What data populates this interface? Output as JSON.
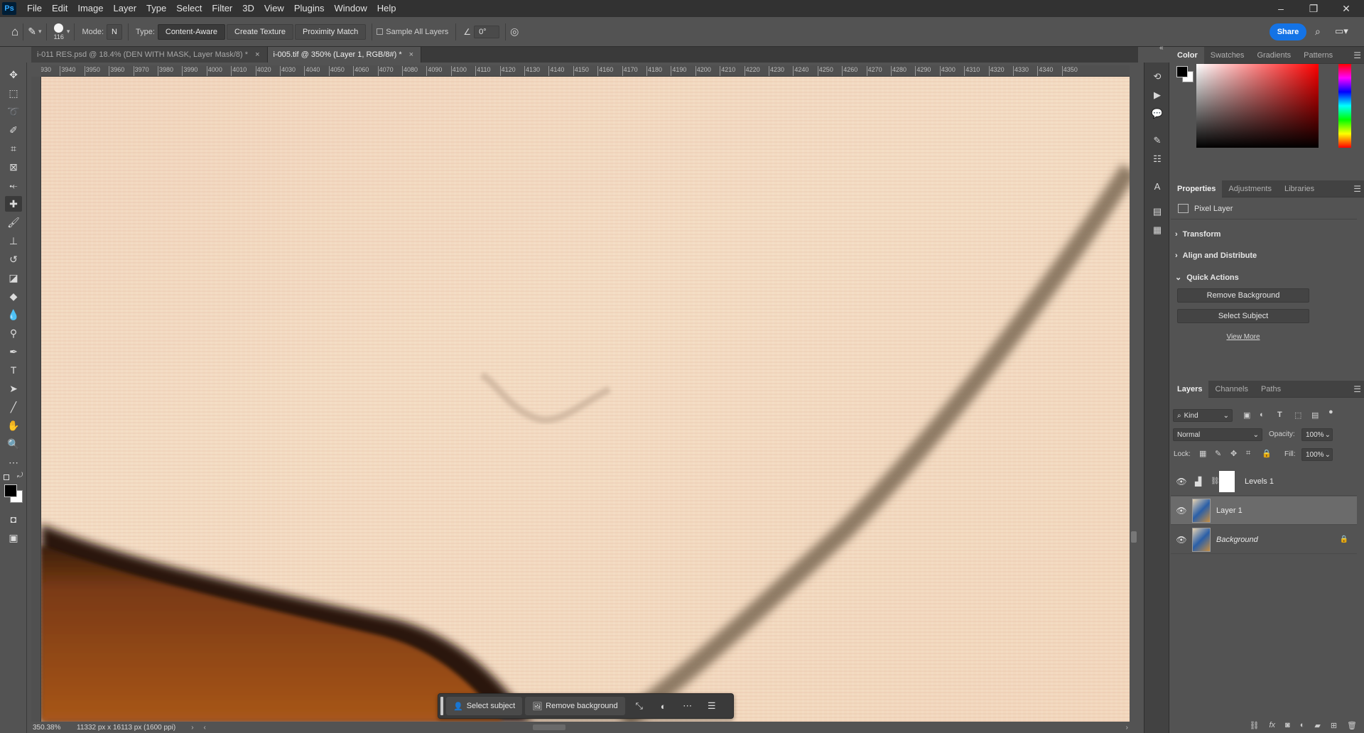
{
  "app": {
    "logo": "Ps"
  },
  "menu": [
    "File",
    "Edit",
    "Image",
    "Layer",
    "Type",
    "Select",
    "Filter",
    "3D",
    "View",
    "Plugins",
    "Window",
    "Help"
  ],
  "window_controls": {
    "minimize": "–",
    "restore": "❐",
    "close": "✕"
  },
  "options_bar": {
    "brush_size": "116",
    "mode_label": "Mode:",
    "mode_value": "N",
    "type_label": "Type:",
    "type_buttons": [
      "Content-Aware",
      "Create Texture",
      "Proximity Match"
    ],
    "sample_all_layers": "Sample All Layers",
    "angle": "0°",
    "share": "Share"
  },
  "tabs": [
    {
      "label": "i-011 RES.psd @ 18.4% (DEN WITH MASK, Layer Mask/8) *",
      "active": false
    },
    {
      "label": "i-005.tif @ 350% (Layer 1, RGB/8#) *",
      "active": true
    }
  ],
  "ruler_ticks": [
    "3930",
    "3940",
    "3950",
    "3960",
    "3970",
    "3980",
    "3990",
    "4000",
    "4010",
    "4020",
    "4030",
    "4040",
    "4050",
    "4060",
    "4070",
    "4080",
    "4090",
    "4100",
    "4110",
    "4120",
    "4130",
    "4140",
    "4150",
    "4160",
    "4170",
    "4180",
    "4190",
    "4200",
    "4210",
    "4220",
    "4230",
    "4240",
    "4250",
    "4260",
    "4270",
    "4280",
    "4290",
    "4300",
    "4310",
    "4320",
    "4330",
    "4340",
    "4350"
  ],
  "status": {
    "zoom": "350.38%",
    "doc_info": "11332 px x 16113 px (1600 ppi)"
  },
  "context_bar": {
    "select_subject": "Select subject",
    "remove_background": "Remove background"
  },
  "color_panel": {
    "tabs": [
      "Color",
      "Swatches",
      "Gradients",
      "Patterns"
    ],
    "foreground": "#000000",
    "background": "#ffffff",
    "hue": "#ff0000"
  },
  "properties_panel": {
    "tabs": [
      "Properties",
      "Adjustments",
      "Libraries"
    ],
    "type": "Pixel Layer",
    "sections": [
      "Transform",
      "Align and Distribute",
      "Quick Actions"
    ],
    "quick_actions": [
      "Remove Background",
      "Select Subject"
    ],
    "view_more": "View More"
  },
  "layers_panel": {
    "tabs": [
      "Layers",
      "Channels",
      "Paths"
    ],
    "filter": "Kind",
    "blend_mode": "Normal",
    "opacity_label": "Opacity:",
    "opacity": "100%",
    "lock_label": "Lock:",
    "fill_label": "Fill:",
    "fill": "100%",
    "layers": [
      {
        "name": "Levels 1",
        "visible": true,
        "selected": false
      },
      {
        "name": "Layer 1",
        "visible": true,
        "selected": true
      },
      {
        "name": "Background",
        "visible": true,
        "selected": false,
        "locked": true
      }
    ]
  },
  "colors": {
    "accent": "#1473e6",
    "canvas_base": "#f2d8bd"
  }
}
